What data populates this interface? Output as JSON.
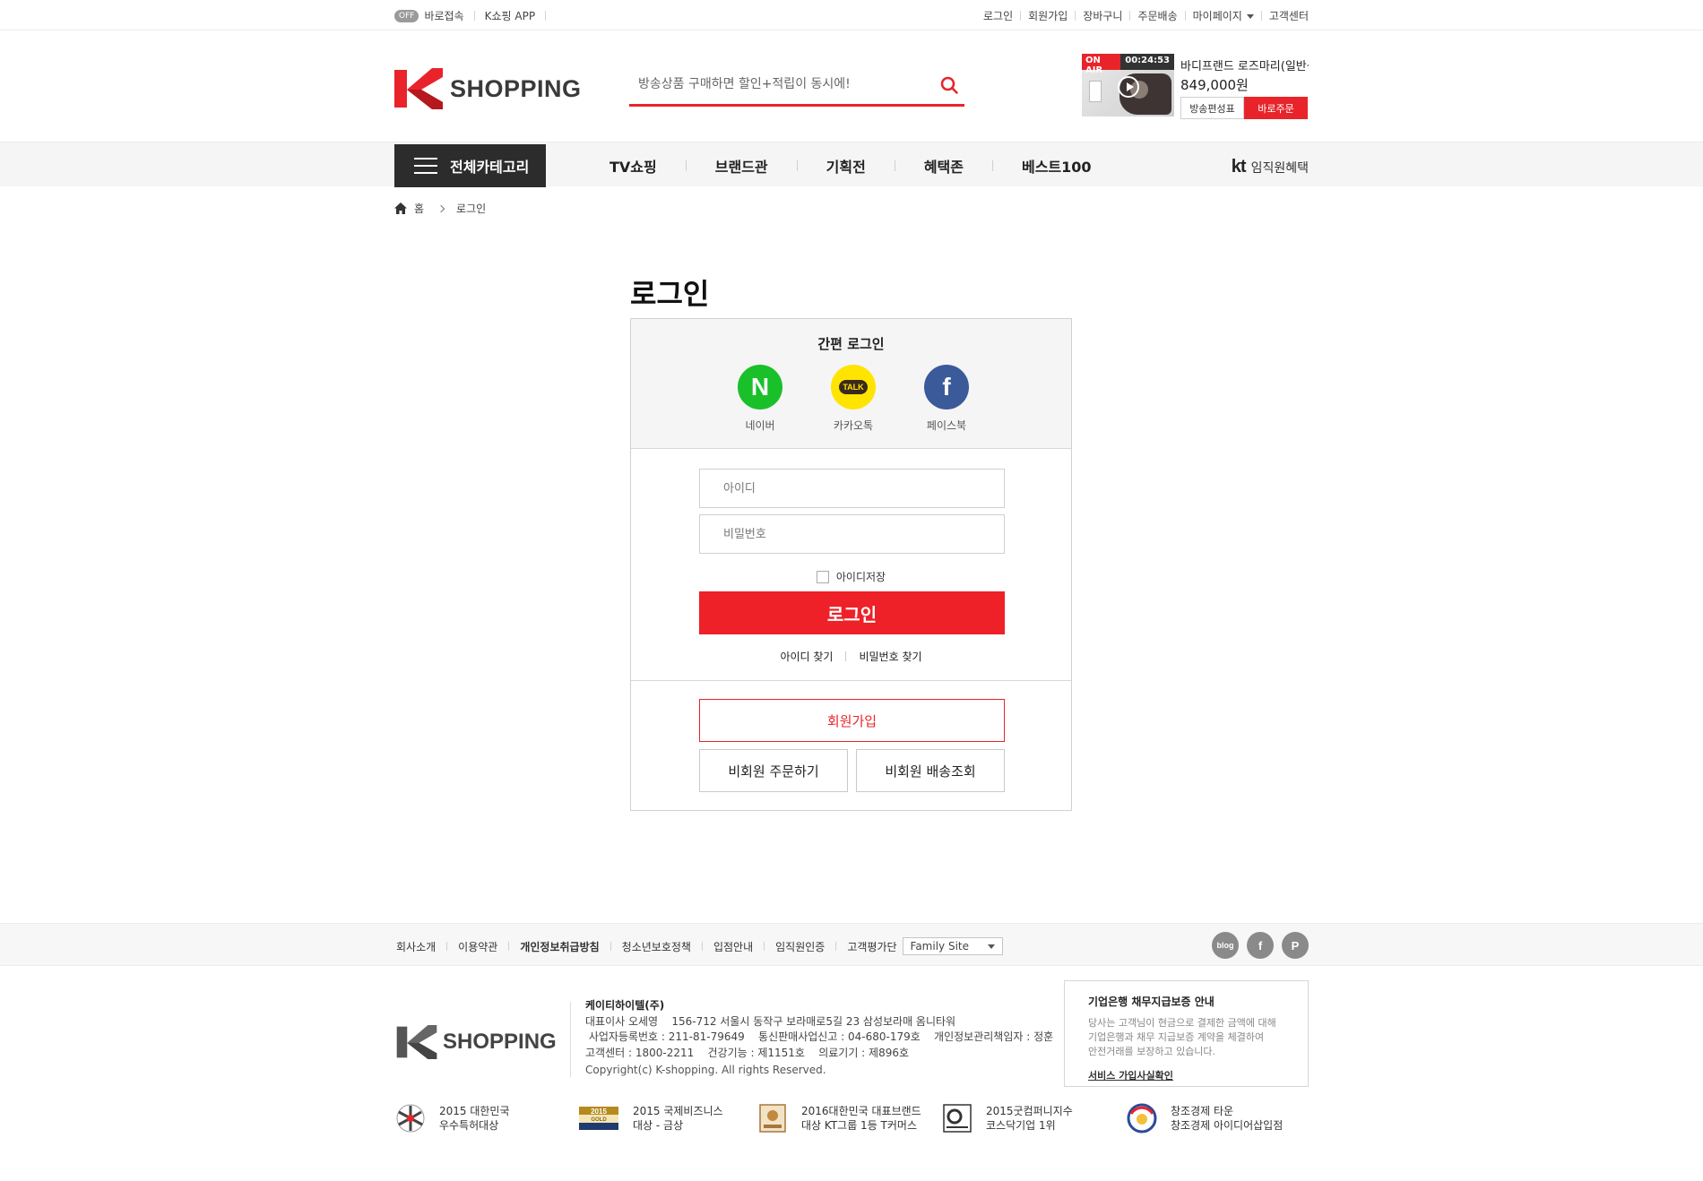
{
  "topbar": {
    "off_badge": "OFF",
    "quick_access": "바로접속",
    "app": "K쇼핑 APP",
    "links": [
      "로그인",
      "회원가입",
      "장바구니",
      "주문배송",
      "마이페이지",
      "고객센터"
    ]
  },
  "header": {
    "logo_text": "SHOPPING",
    "search_placeholder": "방송상품 구매하면 할인+적립이 동시에!",
    "onair": {
      "badge": "ON AIR",
      "timer": "00:24:53",
      "product": "바디프랜드 로즈마리(일반상...",
      "price": "849,000원",
      "schedule_btn": "방송편성표",
      "order_btn": "바로주문"
    }
  },
  "gnb": {
    "all_category": "전체카테고리",
    "menu": [
      "TV쇼핑",
      "브랜드관",
      "기획전",
      "혜택존",
      "베스트100"
    ],
    "kt_logo": "kt",
    "kt_benefit": "임직원혜택"
  },
  "breadcrumb": {
    "home": "홈",
    "current": "로그인"
  },
  "login": {
    "title": "로그인",
    "easy_title": "간편 로그인",
    "sns": [
      {
        "label": "네이버",
        "mark": "N"
      },
      {
        "label": "카카오톡",
        "mark": "TALK"
      },
      {
        "label": "페이스북",
        "mark": "f"
      }
    ],
    "id_placeholder": "아이디",
    "pw_placeholder": "비밀번호",
    "save_id": "아이디저장",
    "login_button": "로그인",
    "find_id": "아이디 찾기",
    "find_pw": "비밀번호 찾기",
    "join_button": "회원가입",
    "guest_order": "비회원 주문하기",
    "guest_delivery": "비회원 배송조회"
  },
  "footer": {
    "nav": [
      "회사소개",
      "이용약관",
      "개인정보취급방침",
      "청소년보호정책",
      "입점안내",
      "임직원인증",
      "고객평가단"
    ],
    "family_site": "Family Site",
    "social": [
      "blog",
      "f",
      "P"
    ],
    "logo_text": "SHOPPING",
    "company_name": "케이티하이텔(주)",
    "info_lines": [
      "대표이사 오세영    156-712 서울시 동작구 보라매로5길 23 삼성보라매 옴니타워",
      " 사업자등록번호 : 211-81-79649    통신판매사업신고 : 04-680-179호    개인정보관리책임자 : 정훈",
      "고객센터 : 1800-2211    건강기능 : 제1151호    의료기기 : 제896호"
    ],
    "copyright": "Copyright(c) K-shopping. All rights Reserved.",
    "guarantee": {
      "title": "기업은행 채무지급보증 안내",
      "text": [
        "당사는 고객님이 현금으로 결제한 금액에 대해",
        "기업은행과 채무 지급보증 계약을 체결하여",
        "안전거래를 보장하고 있습니다."
      ],
      "link": "서비스 가입사실확인"
    },
    "awards": [
      {
        "line1": "2015 대한민국",
        "line2": "우수특허대상"
      },
      {
        "line1": "2015 국제비즈니스",
        "line2": "대상 - 금상"
      },
      {
        "line1": "2016대한민국 대표브랜드",
        "line2": "대상 KT그룹 1등 T커머스"
      },
      {
        "line1": "2015굿컴퍼니지수",
        "line2": "코스닥기업 1위"
      },
      {
        "line1": "창조경제 타운",
        "line2": "창조경제 아이디어삽입점"
      }
    ]
  },
  "colors": {
    "brand_red": "#e8242a",
    "naver": "#19c02a",
    "kakao": "#ffe400",
    "facebook": "#3b5a9a",
    "dark": "#2c2c2c"
  }
}
